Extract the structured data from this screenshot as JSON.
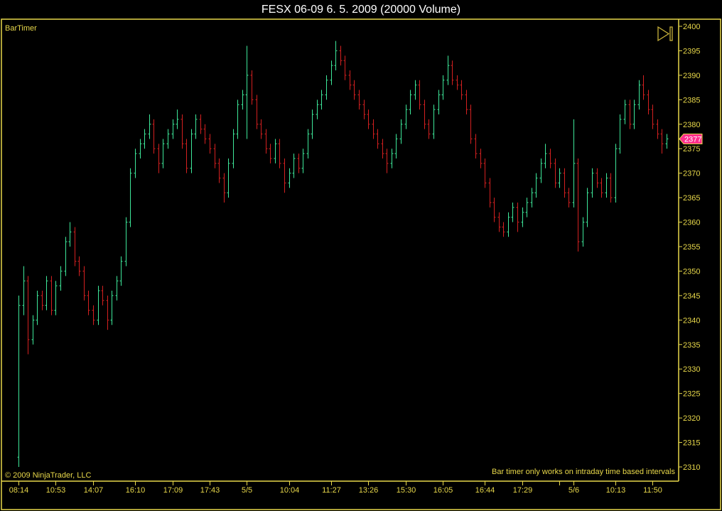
{
  "window": {
    "title": "FESX 06-09  6. 5. 2009 (20000 Volume)"
  },
  "indicator_label": "BarTimer",
  "copyright": "© 2009 NinjaTrader, LLC",
  "bar_timer_message": "Bar timer only works on intraday time based intervals",
  "last_price_label": "2377",
  "colors": {
    "up": "#3ee89a",
    "down": "#d42020",
    "axis": "#e8d84a",
    "last_price": "#ff2d8c",
    "background": "#000000"
  },
  "chart_data": {
    "type": "ohlc",
    "title": "FESX 06-09  6. 5. 2009 (20000 Volume)",
    "ylim": [
      2308,
      2401.5
    ],
    "y_ticks": [
      2400,
      2395,
      2390,
      2385,
      2380,
      2375,
      2370,
      2365,
      2360,
      2355,
      2350,
      2345,
      2340,
      2335,
      2330,
      2325,
      2320,
      2315,
      2310
    ],
    "x_ticks": [
      {
        "bar": 0,
        "label": "08:14"
      },
      {
        "bar": 8,
        "label": "10:53"
      },
      {
        "bar": 16,
        "label": "14:07"
      },
      {
        "bar": 25,
        "label": "16:10"
      },
      {
        "bar": 33,
        "label": "17:09"
      },
      {
        "bar": 41,
        "label": "17:43"
      },
      {
        "bar": 49,
        "label": "5/5"
      },
      {
        "bar": 58,
        "label": "10:04"
      },
      {
        "bar": 67,
        "label": "11:27"
      },
      {
        "bar": 75,
        "label": "13:26"
      },
      {
        "bar": 83,
        "label": "15:30"
      },
      {
        "bar": 91,
        "label": "16:05"
      },
      {
        "bar": 100,
        "label": "16:44"
      },
      {
        "bar": 108,
        "label": "17:29"
      },
      {
        "bar": 116,
        "label": ""
      },
      {
        "bar": 119,
        "label": "5/6"
      },
      {
        "bar": 128,
        "label": "10:13"
      },
      {
        "bar": 136,
        "label": "11:50"
      }
    ],
    "last_price": 2377,
    "bars_ohlc": [
      [
        2312,
        2345,
        2310,
        2343
      ],
      [
        2343,
        2351,
        2341,
        2348
      ],
      [
        2348,
        2349,
        2333,
        2336
      ],
      [
        2336,
        2341,
        2335,
        2340
      ],
      [
        2340,
        2346,
        2339,
        2345
      ],
      [
        2345,
        2346,
        2342,
        2343
      ],
      [
        2343,
        2349,
        2342,
        2348
      ],
      [
        2348,
        2349,
        2341,
        2342
      ],
      [
        2342,
        2348,
        2341,
        2347
      ],
      [
        2347,
        2351,
        2346,
        2350
      ],
      [
        2350,
        2357,
        2349,
        2356
      ],
      [
        2356,
        2360,
        2355,
        2358
      ],
      [
        2358,
        2359,
        2351,
        2352
      ],
      [
        2352,
        2353,
        2349,
        2350
      ],
      [
        2350,
        2351,
        2344,
        2345
      ],
      [
        2345,
        2346,
        2341,
        2342
      ],
      [
        2342,
        2343,
        2339,
        2340
      ],
      [
        2340,
        2347,
        2339,
        2346
      ],
      [
        2346,
        2347,
        2343,
        2344
      ],
      [
        2344,
        2345,
        2338,
        2340
      ],
      [
        2340,
        2346,
        2339,
        2345
      ],
      [
        2345,
        2349,
        2344,
        2348
      ],
      [
        2348,
        2353,
        2347,
        2352
      ],
      [
        2352,
        2361,
        2351,
        2360
      ],
      [
        2360,
        2371,
        2359,
        2370
      ],
      [
        2370,
        2375,
        2369,
        2374
      ],
      [
        2374,
        2377,
        2373,
        2376
      ],
      [
        2376,
        2379,
        2375,
        2378
      ],
      [
        2378,
        2382,
        2377,
        2380
      ],
      [
        2380,
        2381,
        2374,
        2375
      ],
      [
        2375,
        2376,
        2370,
        2372
      ],
      [
        2372,
        2377,
        2371,
        2376
      ],
      [
        2376,
        2379,
        2375,
        2378
      ],
      [
        2378,
        2381,
        2377,
        2380
      ],
      [
        2380,
        2383,
        2379,
        2381
      ],
      [
        2381,
        2382,
        2375,
        2376
      ],
      [
        2376,
        2377,
        2370,
        2371
      ],
      [
        2371,
        2379,
        2370,
        2378
      ],
      [
        2378,
        2382,
        2377,
        2381
      ],
      [
        2381,
        2382,
        2378,
        2379
      ],
      [
        2379,
        2380,
        2376,
        2377
      ],
      [
        2377,
        2378,
        2374,
        2375
      ],
      [
        2375,
        2376,
        2371,
        2372
      ],
      [
        2372,
        2373,
        2368,
        2369
      ],
      [
        2369,
        2370,
        2364,
        2366
      ],
      [
        2366,
        2373,
        2365,
        2372
      ],
      [
        2372,
        2379,
        2371,
        2378
      ],
      [
        2378,
        2385,
        2377,
        2384
      ],
      [
        2384,
        2387,
        2383,
        2386
      ],
      [
        2386,
        2396,
        2377,
        2390
      ],
      [
        2390,
        2391,
        2384,
        2385
      ],
      [
        2385,
        2386,
        2379,
        2380
      ],
      [
        2380,
        2381,
        2377,
        2378
      ],
      [
        2378,
        2379,
        2374,
        2375
      ],
      [
        2375,
        2376,
        2372,
        2373
      ],
      [
        2373,
        2377,
        2372,
        2376
      ],
      [
        2376,
        2377,
        2371,
        2372
      ],
      [
        2372,
        2373,
        2366,
        2368
      ],
      [
        2368,
        2371,
        2367,
        2370
      ],
      [
        2370,
        2374,
        2369,
        2373
      ],
      [
        2373,
        2374,
        2370,
        2371
      ],
      [
        2371,
        2375,
        2370,
        2374
      ],
      [
        2374,
        2379,
        2373,
        2378
      ],
      [
        2378,
        2383,
        2377,
        2382
      ],
      [
        2382,
        2385,
        2381,
        2384
      ],
      [
        2384,
        2387,
        2383,
        2386
      ],
      [
        2386,
        2390,
        2385,
        2389
      ],
      [
        2389,
        2393,
        2388,
        2392
      ],
      [
        2392,
        2397,
        2391,
        2395
      ],
      [
        2395,
        2396,
        2392,
        2393
      ],
      [
        2393,
        2394,
        2389,
        2390
      ],
      [
        2390,
        2391,
        2387,
        2388
      ],
      [
        2388,
        2389,
        2385,
        2386
      ],
      [
        2386,
        2387,
        2383,
        2384
      ],
      [
        2384,
        2385,
        2381,
        2382
      ],
      [
        2382,
        2383,
        2379,
        2380
      ],
      [
        2380,
        2381,
        2377,
        2378
      ],
      [
        2378,
        2379,
        2375,
        2376
      ],
      [
        2376,
        2377,
        2373,
        2374
      ],
      [
        2374,
        2375,
        2370,
        2372
      ],
      [
        2372,
        2375,
        2371,
        2374
      ],
      [
        2374,
        2378,
        2373,
        2377
      ],
      [
        2377,
        2381,
        2376,
        2380
      ],
      [
        2380,
        2384,
        2379,
        2383
      ],
      [
        2383,
        2387,
        2382,
        2386
      ],
      [
        2386,
        2389,
        2385,
        2388
      ],
      [
        2388,
        2389,
        2383,
        2384
      ],
      [
        2384,
        2385,
        2379,
        2380
      ],
      [
        2380,
        2381,
        2377,
        2378
      ],
      [
        2378,
        2384,
        2377,
        2383
      ],
      [
        2383,
        2387,
        2382,
        2386
      ],
      [
        2386,
        2390,
        2385,
        2389
      ],
      [
        2389,
        2394,
        2388,
        2392
      ],
      [
        2392,
        2393,
        2388,
        2389
      ],
      [
        2389,
        2390,
        2387,
        2388
      ],
      [
        2388,
        2389,
        2385,
        2386
      ],
      [
        2386,
        2387,
        2382,
        2383
      ],
      [
        2383,
        2384,
        2376,
        2377
      ],
      [
        2377,
        2378,
        2373,
        2374
      ],
      [
        2374,
        2375,
        2371,
        2372
      ],
      [
        2372,
        2373,
        2367,
        2368
      ],
      [
        2368,
        2369,
        2363,
        2364
      ],
      [
        2364,
        2365,
        2360,
        2361
      ],
      [
        2361,
        2362,
        2358,
        2359
      ],
      [
        2359,
        2360,
        2357,
        2358
      ],
      [
        2358,
        2362,
        2357,
        2361
      ],
      [
        2361,
        2364,
        2360,
        2363
      ],
      [
        2363,
        2364,
        2358,
        2360
      ],
      [
        2360,
        2363,
        2359,
        2362
      ],
      [
        2362,
        2365,
        2361,
        2364
      ],
      [
        2364,
        2367,
        2363,
        2366
      ],
      [
        2366,
        2370,
        2365,
        2369
      ],
      [
        2369,
        2373,
        2368,
        2372
      ],
      [
        2372,
        2376,
        2371,
        2374
      ],
      [
        2374,
        2375,
        2371,
        2372
      ],
      [
        2372,
        2373,
        2367,
        2368
      ],
      [
        2368,
        2371,
        2367,
        2370
      ],
      [
        2370,
        2371,
        2365,
        2366
      ],
      [
        2366,
        2367,
        2363,
        2364
      ],
      [
        2364,
        2381,
        2363,
        2372
      ],
      [
        2372,
        2373,
        2354,
        2356
      ],
      [
        2356,
        2361,
        2355,
        2360
      ],
      [
        2360,
        2367,
        2359,
        2366
      ],
      [
        2366,
        2371,
        2365,
        2370
      ],
      [
        2370,
        2371,
        2367,
        2368
      ],
      [
        2368,
        2369,
        2365,
        2366
      ],
      [
        2366,
        2370,
        2365,
        2369
      ],
      [
        2369,
        2370,
        2364,
        2365
      ],
      [
        2365,
        2376,
        2364,
        2375
      ],
      [
        2375,
        2382,
        2374,
        2381
      ],
      [
        2381,
        2385,
        2380,
        2384
      ],
      [
        2384,
        2385,
        2379,
        2380
      ],
      [
        2380,
        2385,
        2379,
        2384
      ],
      [
        2384,
        2389,
        2383,
        2388
      ],
      [
        2388,
        2390,
        2385,
        2386
      ],
      [
        2386,
        2387,
        2382,
        2383
      ],
      [
        2383,
        2384,
        2379,
        2380
      ],
      [
        2380,
        2381,
        2377,
        2378
      ],
      [
        2378,
        2379,
        2374,
        2376
      ],
      [
        2376,
        2378,
        2375,
        2377
      ]
    ]
  }
}
